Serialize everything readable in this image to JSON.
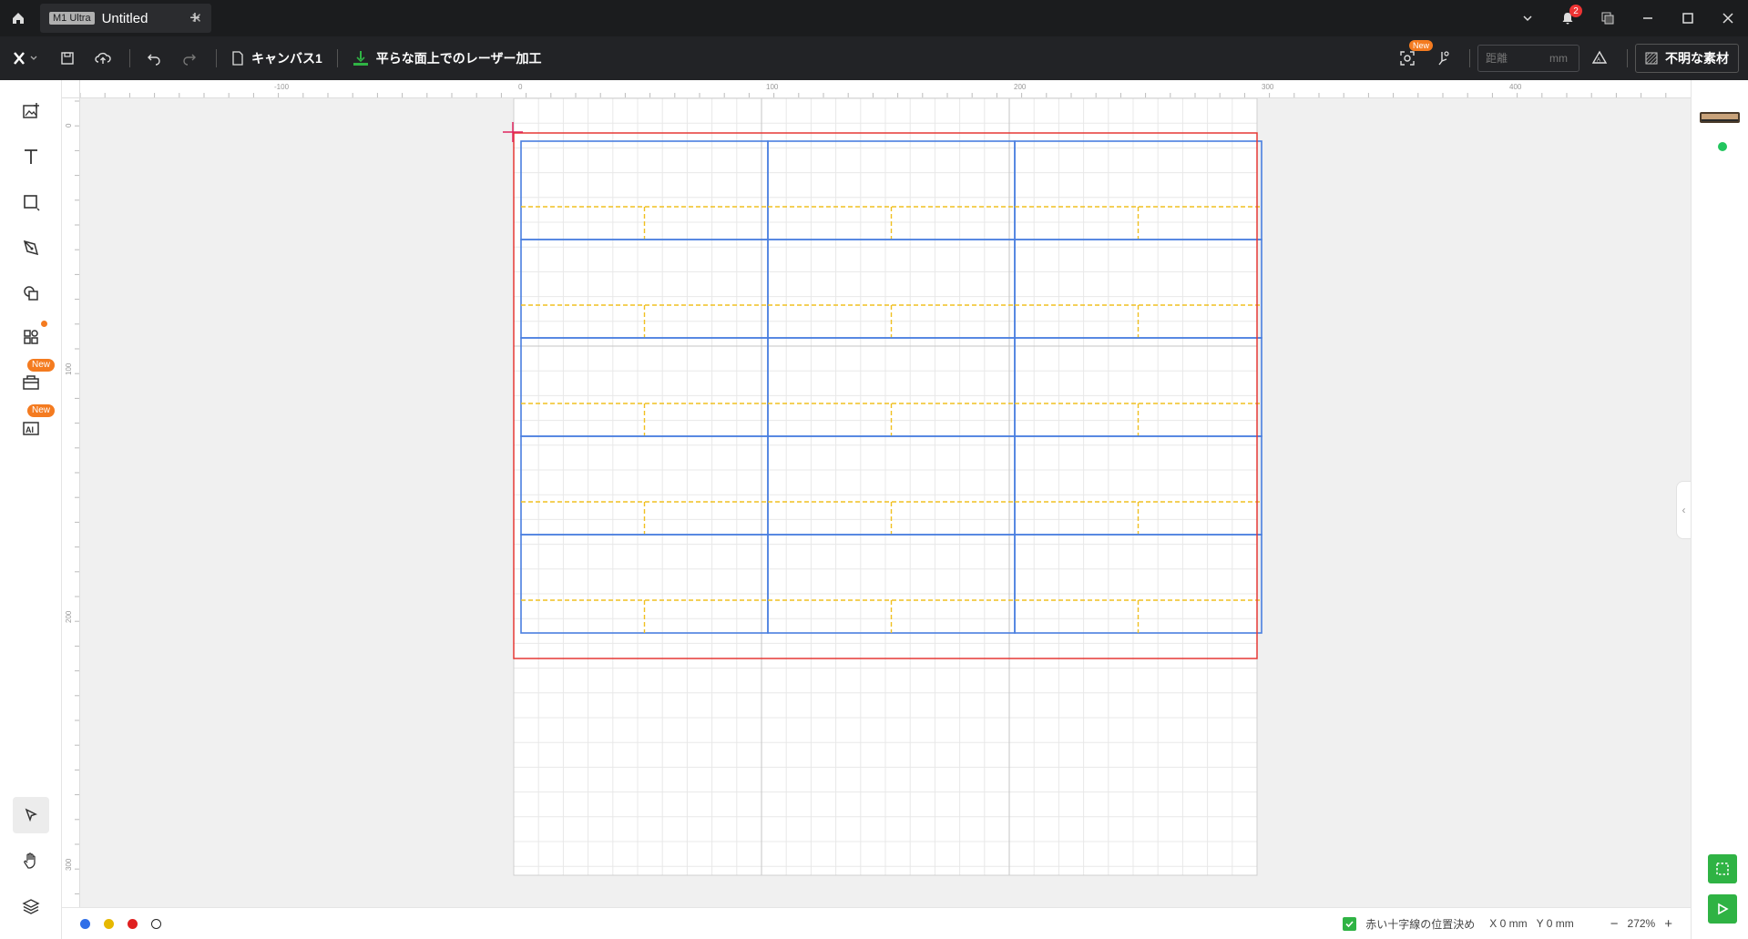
{
  "titlebar": {
    "model_badge": "M1 Ultra",
    "tab_title": "Untitled",
    "tab_close": "✕",
    "add_tab": "+",
    "notification_count": "2"
  },
  "toolbar": {
    "canvas_label": "キャンバス1",
    "mode_label": "平らな面上でのレーザー加工",
    "new_badge": "New",
    "distance_placeholder": "距離",
    "distance_unit": "mm",
    "material_label": "不明な素材"
  },
  "leftpanel": {
    "new_badge_1": "New",
    "new_badge_2": "New"
  },
  "ruler": {
    "top_labels": [
      "-100",
      "0",
      "100",
      "200",
      "300",
      "400"
    ],
    "left_labels": [
      "0",
      "100",
      "200",
      "300"
    ]
  },
  "statusbar": {
    "layer_colors": [
      "#2f6ee8",
      "#e6b800",
      "#e02020",
      "#ffffff"
    ],
    "crosshair_label": "赤い十字線の位置決め",
    "x_readout": "X 0 mm",
    "y_readout": "Y 0 mm",
    "zoom_minus": "−",
    "zoom_value": "272%",
    "zoom_plus": "+"
  },
  "colors": {
    "accent_green": "#2fb344",
    "new_orange": "#f47b20",
    "grid_blue": "#4a7fe0",
    "dashed_yellow": "#f0c020",
    "boundary_red": "#e53935"
  }
}
